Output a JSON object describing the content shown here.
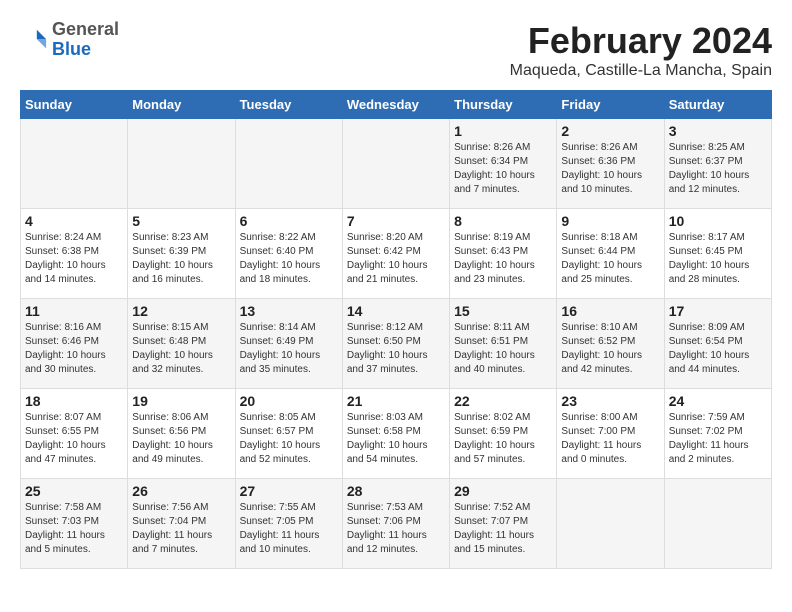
{
  "header": {
    "logo_line1": "General",
    "logo_line2": "Blue",
    "main_title": "February 2024",
    "subtitle": "Maqueda, Castille-La Mancha, Spain"
  },
  "days_of_week": [
    "Sunday",
    "Monday",
    "Tuesday",
    "Wednesday",
    "Thursday",
    "Friday",
    "Saturday"
  ],
  "weeks": [
    [
      {
        "day": "",
        "info": ""
      },
      {
        "day": "",
        "info": ""
      },
      {
        "day": "",
        "info": ""
      },
      {
        "day": "",
        "info": ""
      },
      {
        "day": "1",
        "info": "Sunrise: 8:26 AM\nSunset: 6:34 PM\nDaylight: 10 hours\nand 7 minutes."
      },
      {
        "day": "2",
        "info": "Sunrise: 8:26 AM\nSunset: 6:36 PM\nDaylight: 10 hours\nand 10 minutes."
      },
      {
        "day": "3",
        "info": "Sunrise: 8:25 AM\nSunset: 6:37 PM\nDaylight: 10 hours\nand 12 minutes."
      }
    ],
    [
      {
        "day": "4",
        "info": "Sunrise: 8:24 AM\nSunset: 6:38 PM\nDaylight: 10 hours\nand 14 minutes."
      },
      {
        "day": "5",
        "info": "Sunrise: 8:23 AM\nSunset: 6:39 PM\nDaylight: 10 hours\nand 16 minutes."
      },
      {
        "day": "6",
        "info": "Sunrise: 8:22 AM\nSunset: 6:40 PM\nDaylight: 10 hours\nand 18 minutes."
      },
      {
        "day": "7",
        "info": "Sunrise: 8:20 AM\nSunset: 6:42 PM\nDaylight: 10 hours\nand 21 minutes."
      },
      {
        "day": "8",
        "info": "Sunrise: 8:19 AM\nSunset: 6:43 PM\nDaylight: 10 hours\nand 23 minutes."
      },
      {
        "day": "9",
        "info": "Sunrise: 8:18 AM\nSunset: 6:44 PM\nDaylight: 10 hours\nand 25 minutes."
      },
      {
        "day": "10",
        "info": "Sunrise: 8:17 AM\nSunset: 6:45 PM\nDaylight: 10 hours\nand 28 minutes."
      }
    ],
    [
      {
        "day": "11",
        "info": "Sunrise: 8:16 AM\nSunset: 6:46 PM\nDaylight: 10 hours\nand 30 minutes."
      },
      {
        "day": "12",
        "info": "Sunrise: 8:15 AM\nSunset: 6:48 PM\nDaylight: 10 hours\nand 32 minutes."
      },
      {
        "day": "13",
        "info": "Sunrise: 8:14 AM\nSunset: 6:49 PM\nDaylight: 10 hours\nand 35 minutes."
      },
      {
        "day": "14",
        "info": "Sunrise: 8:12 AM\nSunset: 6:50 PM\nDaylight: 10 hours\nand 37 minutes."
      },
      {
        "day": "15",
        "info": "Sunrise: 8:11 AM\nSunset: 6:51 PM\nDaylight: 10 hours\nand 40 minutes."
      },
      {
        "day": "16",
        "info": "Sunrise: 8:10 AM\nSunset: 6:52 PM\nDaylight: 10 hours\nand 42 minutes."
      },
      {
        "day": "17",
        "info": "Sunrise: 8:09 AM\nSunset: 6:54 PM\nDaylight: 10 hours\nand 44 minutes."
      }
    ],
    [
      {
        "day": "18",
        "info": "Sunrise: 8:07 AM\nSunset: 6:55 PM\nDaylight: 10 hours\nand 47 minutes."
      },
      {
        "day": "19",
        "info": "Sunrise: 8:06 AM\nSunset: 6:56 PM\nDaylight: 10 hours\nand 49 minutes."
      },
      {
        "day": "20",
        "info": "Sunrise: 8:05 AM\nSunset: 6:57 PM\nDaylight: 10 hours\nand 52 minutes."
      },
      {
        "day": "21",
        "info": "Sunrise: 8:03 AM\nSunset: 6:58 PM\nDaylight: 10 hours\nand 54 minutes."
      },
      {
        "day": "22",
        "info": "Sunrise: 8:02 AM\nSunset: 6:59 PM\nDaylight: 10 hours\nand 57 minutes."
      },
      {
        "day": "23",
        "info": "Sunrise: 8:00 AM\nSunset: 7:00 PM\nDaylight: 11 hours\nand 0 minutes."
      },
      {
        "day": "24",
        "info": "Sunrise: 7:59 AM\nSunset: 7:02 PM\nDaylight: 11 hours\nand 2 minutes."
      }
    ],
    [
      {
        "day": "25",
        "info": "Sunrise: 7:58 AM\nSunset: 7:03 PM\nDaylight: 11 hours\nand 5 minutes."
      },
      {
        "day": "26",
        "info": "Sunrise: 7:56 AM\nSunset: 7:04 PM\nDaylight: 11 hours\nand 7 minutes."
      },
      {
        "day": "27",
        "info": "Sunrise: 7:55 AM\nSunset: 7:05 PM\nDaylight: 11 hours\nand 10 minutes."
      },
      {
        "day": "28",
        "info": "Sunrise: 7:53 AM\nSunset: 7:06 PM\nDaylight: 11 hours\nand 12 minutes."
      },
      {
        "day": "29",
        "info": "Sunrise: 7:52 AM\nSunset: 7:07 PM\nDaylight: 11 hours\nand 15 minutes."
      },
      {
        "day": "",
        "info": ""
      },
      {
        "day": "",
        "info": ""
      }
    ]
  ]
}
